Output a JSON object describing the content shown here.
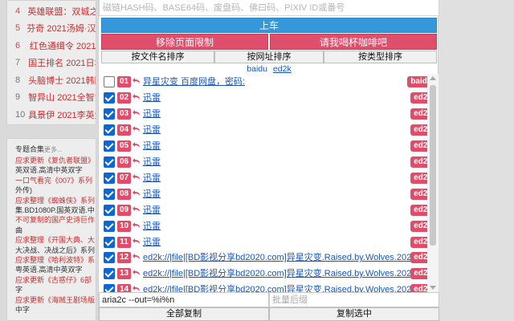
{
  "background": {
    "rankings": [
      {
        "num": "4",
        "title": "英雄联盟：双城之战"
      },
      {
        "num": "5",
        "title": "芬奇  2021汤姆·汉克斯"
      },
      {
        "num": "6",
        "title": "红色通缉令  2021"
      },
      {
        "num": "7",
        "title": "国王排名  2021日本"
      },
      {
        "num": "8",
        "title": "头脑博士  2021韩国"
      },
      {
        "num": "9",
        "title": "智异山  2021全智贤"
      },
      {
        "num": "10",
        "title": "具景伊  2021李英爱"
      }
    ],
    "topic_title": "专题合集",
    "topic_more": "更多...",
    "topic_lines": [
      {
        "text": "应求更新《复仇者联盟》",
        "color": "red"
      },
      {
        "text": "英双语.高清中英双字",
        "color": "dark"
      },
      {
        "text": "一口气看完《007》系列",
        "color": "red"
      },
      {
        "text": "外传)",
        "color": "dark"
      },
      {
        "text": "应求整理《蜘蛛侠》系列",
        "color": "red"
      },
      {
        "text": "集.BD1080P.国英双语.中",
        "color": "dark"
      },
      {
        "text": "不可复制的国产史诗巨作",
        "color": "red"
      },
      {
        "text": "曲",
        "color": "dark"
      },
      {
        "text": "应求整理《开国大典、大",
        "color": "red"
      },
      {
        "text": "大决战、决战之后》系列",
        "color": "dark"
      },
      {
        "text": "应求整理《哈利波特》系",
        "color": "red"
      },
      {
        "text": "粤英语.高清中英双字",
        "color": "dark"
      },
      {
        "text": "应求更新《古惑仔》6部",
        "color": "red"
      },
      {
        "text": "字",
        "color": "dark"
      },
      {
        "text": "应求更新《海贼王剧场版",
        "color": "red"
      },
      {
        "text": "中字",
        "color": "dark"
      }
    ]
  },
  "panel": {
    "hash_placeholder": "磁链HASH码、BASE64码、废盘码、佛曰码、PIXIV ID或番号",
    "go_label": "上车",
    "remove_limit_label": "移除页面限制",
    "coffee_label": "请我喝杯咖啡吧",
    "sort_filename_label": "按文件名排序",
    "sort_url_label": "按网址排序",
    "sort_type_label": "按类型排序",
    "filter_baidu": "baidu",
    "filter_ed2k": "ed2k",
    "items": [
      {
        "num": "01",
        "checked": false,
        "text": "异星灾变 百度网盘，密码:",
        "tag": "baidu"
      },
      {
        "num": "02",
        "checked": true,
        "text": "迅雷",
        "tag": "ed2k"
      },
      {
        "num": "03",
        "checked": true,
        "text": "迅雷",
        "tag": "ed2k"
      },
      {
        "num": "04",
        "checked": true,
        "text": "迅雷",
        "tag": "ed2k"
      },
      {
        "num": "05",
        "checked": true,
        "text": "迅雷",
        "tag": "ed2k"
      },
      {
        "num": "06",
        "checked": true,
        "text": "迅雷",
        "tag": "ed2k"
      },
      {
        "num": "07",
        "checked": true,
        "text": "迅雷",
        "tag": "ed2k"
      },
      {
        "num": "08",
        "checked": true,
        "text": "迅雷",
        "tag": "ed2k"
      },
      {
        "num": "09",
        "checked": true,
        "text": "迅雷",
        "tag": "ed2k"
      },
      {
        "num": "10",
        "checked": true,
        "text": "迅雷",
        "tag": "ed2k"
      },
      {
        "num": "11",
        "checked": true,
        "text": "迅雷",
        "tag": "ed2k"
      },
      {
        "num": "12",
        "checked": true,
        "text": "ed2k://|file|[BD影视分享bd2020.com]异星灾变.Raised.by.Wolves.2020",
        "tag": "ed2k"
      },
      {
        "num": "13",
        "checked": true,
        "text": "ed2k://|file|[BD影视分享bd2020.com]异星灾变.Raised.by.Wolves.2020",
        "tag": "ed2k"
      },
      {
        "num": "14",
        "checked": true,
        "text": "ed2k://|file|[BD影视分享bd2020.com]异星灾变.Raised.by.Wolves.2020",
        "tag": "ed2k"
      }
    ],
    "aria_value": "aria2c --out=%i%n",
    "suffix_placeholder": "批量后缀",
    "copy_all_label": "全部复制",
    "copy_selected_label": "复制选中"
  }
}
